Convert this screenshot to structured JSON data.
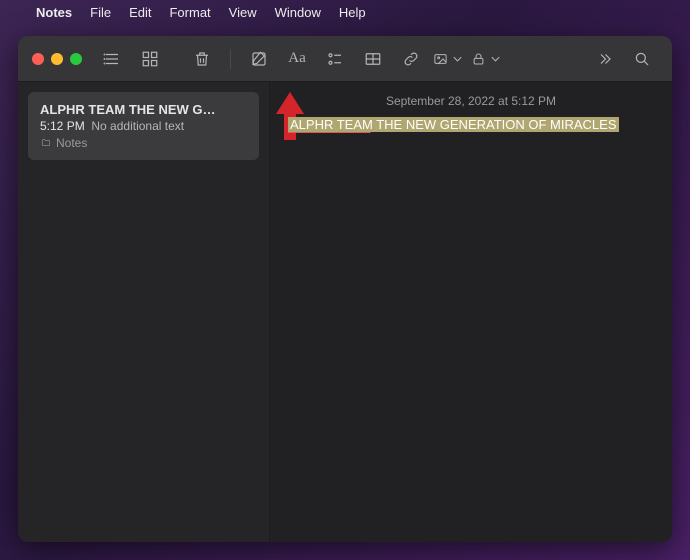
{
  "menubar": {
    "app": "Notes",
    "items": [
      "File",
      "Edit",
      "Format",
      "View",
      "Window",
      "Help"
    ]
  },
  "sidebar": {
    "note": {
      "title": "ALPHR TEAM THE NEW G…",
      "time": "5:12 PM",
      "snippet": "No additional text",
      "folder": "Notes"
    }
  },
  "editor": {
    "timestamp": "September 28, 2022 at 5:12 PM",
    "text": "ALPHR TEAM THE NEW GENERATION OF MIRACLES"
  }
}
